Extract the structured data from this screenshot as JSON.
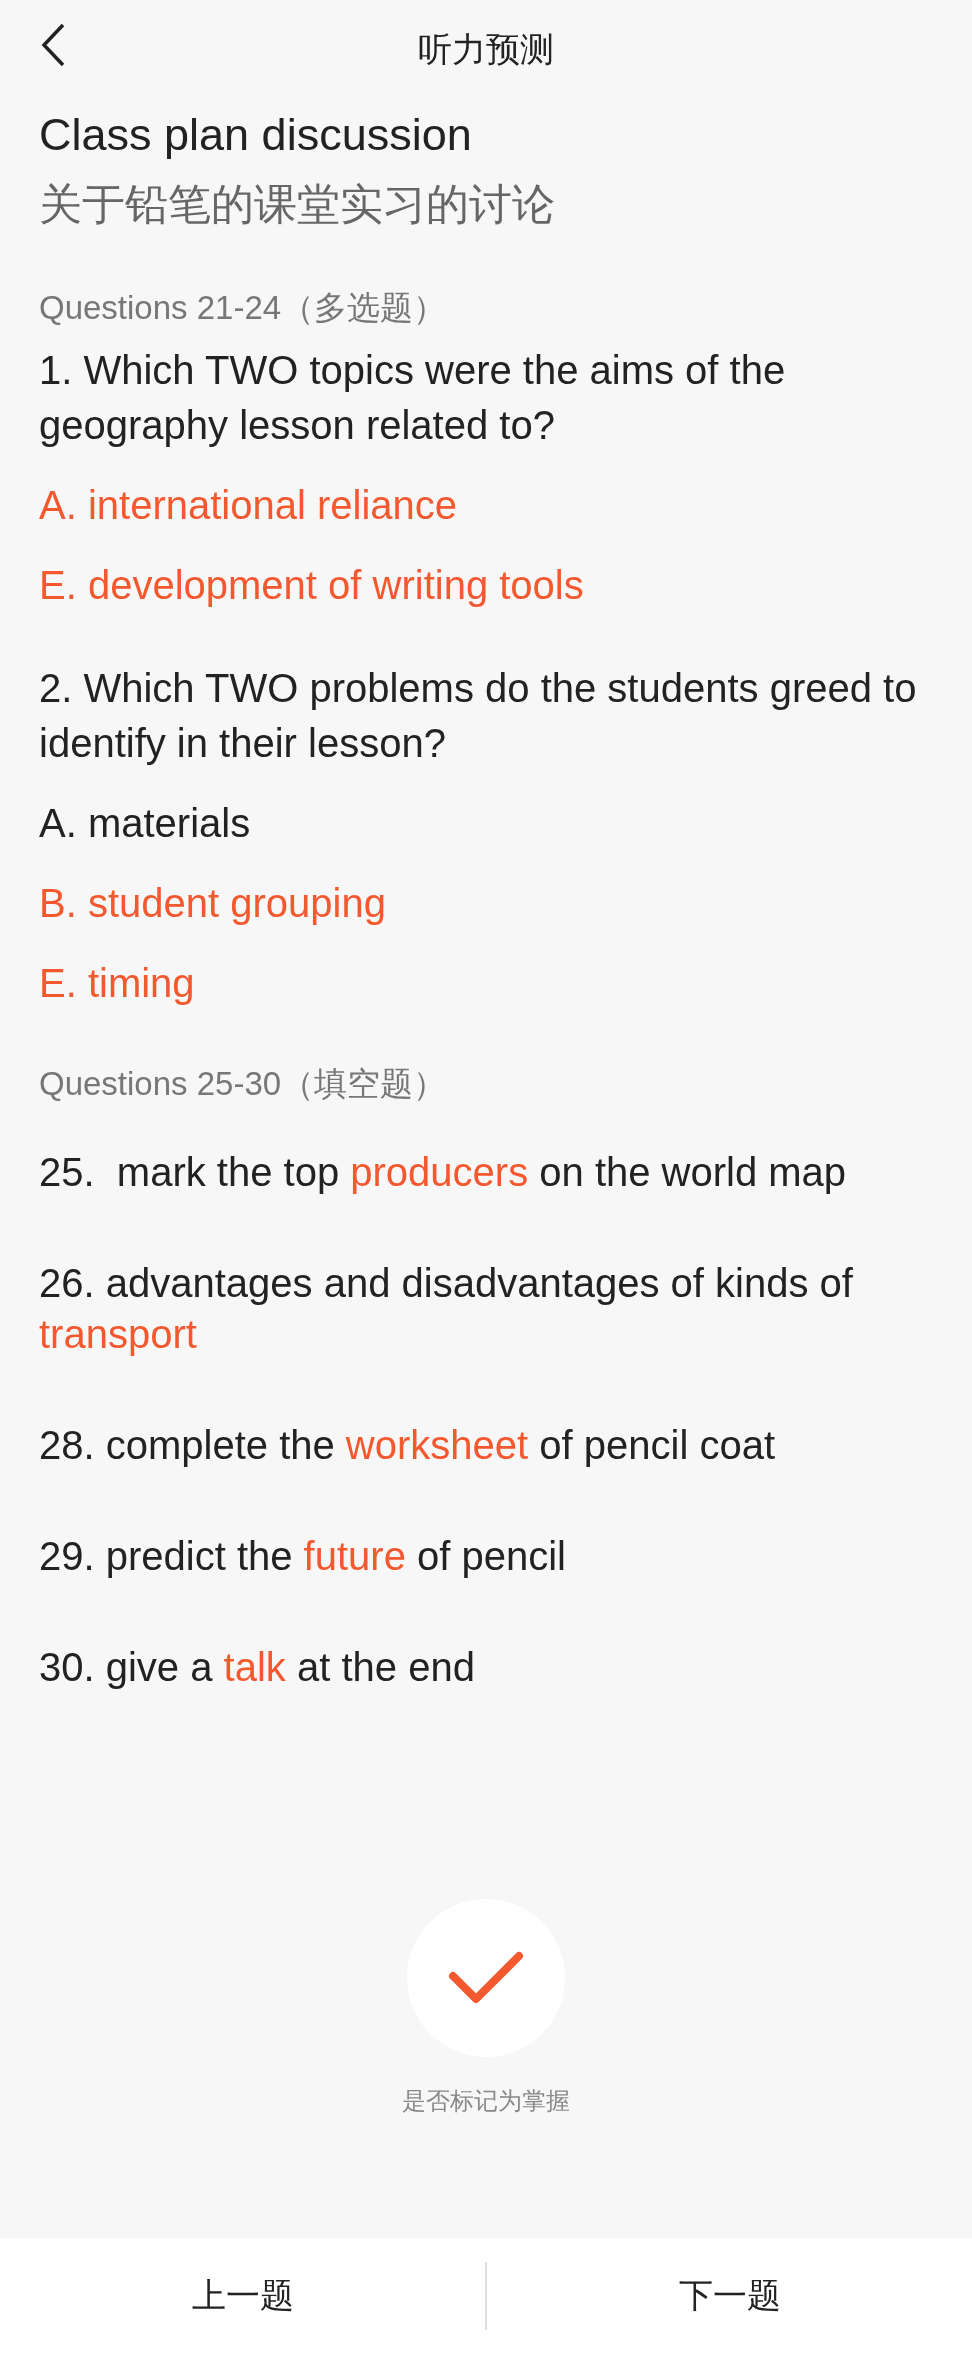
{
  "header": {
    "title": "听力预测"
  },
  "lesson": {
    "title": "Class plan discussion",
    "subtitle": "关于铅笔的课堂实习的讨论"
  },
  "sections": [
    {
      "kind": "choice",
      "heading": "Questions 21-24（多选题）",
      "questions": [
        {
          "text": "1. Which TWO topics were the aims of the geography lesson related to?",
          "options": [
            {
              "text": "A. international reliance",
              "selected": true
            },
            {
              "text": "E. development of writing tools",
              "selected": true
            }
          ]
        },
        {
          "text": "2. Which TWO problems do the students greed to identify in their lesson?",
          "options": [
            {
              "text": "A. materials",
              "selected": false
            },
            {
              "text": "B. student grouping",
              "selected": true
            },
            {
              "text": "E. timing",
              "selected": true
            }
          ]
        }
      ]
    },
    {
      "kind": "fill",
      "heading": "Questions 25-30（填空题）",
      "items": [
        {
          "parts": [
            {
              "text": "25.  mark the top ",
              "answer": false
            },
            {
              "text": "producers",
              "answer": true
            },
            {
              "text": " on the world map",
              "answer": false
            }
          ]
        },
        {
          "parts": [
            {
              "text": "26. advantages and disadvantages of kinds of ",
              "answer": false
            },
            {
              "text": "transport",
              "answer": true
            }
          ]
        },
        {
          "parts": [
            {
              "text": "28. complete the ",
              "answer": false
            },
            {
              "text": "worksheet",
              "answer": true
            },
            {
              "text": " of pencil coat",
              "answer": false
            }
          ]
        },
        {
          "parts": [
            {
              "text": "29. predict the ",
              "answer": false
            },
            {
              "text": "future",
              "answer": true
            },
            {
              "text": " of pencil",
              "answer": false
            }
          ]
        },
        {
          "parts": [
            {
              "text": "30. give a ",
              "answer": false
            },
            {
              "text": "talk",
              "answer": true
            },
            {
              "text": " at the end",
              "answer": false
            }
          ]
        }
      ]
    }
  ],
  "mastery": {
    "caption": "是否标记为掌握",
    "marked": true
  },
  "footer": {
    "prev": "上一题",
    "next": "下一题"
  }
}
